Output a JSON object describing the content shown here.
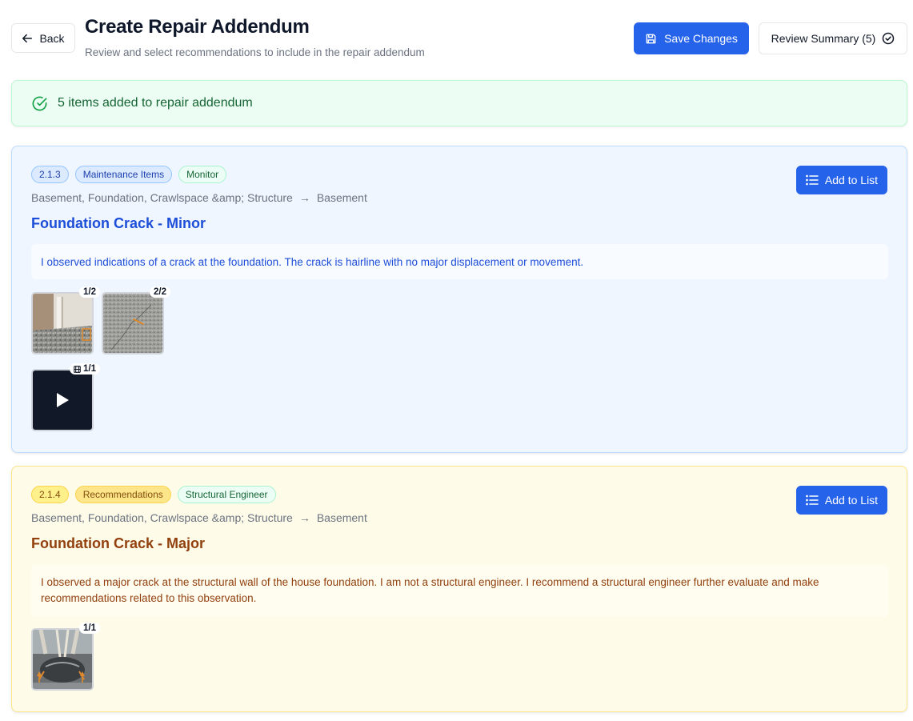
{
  "header": {
    "back_label": "Back",
    "title": "Create Repair Addendum",
    "subtitle": "Review and select recommendations to include in the repair addendum",
    "save_label": "Save Changes",
    "review_label": "Review Summary (5)"
  },
  "banner": {
    "text": "5 items added to repair addendum"
  },
  "items": [
    {
      "number": "2.1.3",
      "category": "Maintenance Items",
      "tag": "Monitor",
      "section": "Basement, Foundation, Crawlspace &amp; Structure",
      "arrow": "→",
      "location": "Basement",
      "title": "Foundation Crack - Minor",
      "description": "I observed indications of a crack at the foundation. The crack is hairline with no major displacement or movement.",
      "add_label": "Add to List",
      "photos": [
        {
          "counter": "1/2"
        },
        {
          "counter": "2/2"
        }
      ],
      "videos": [
        {
          "counter": "1/1"
        }
      ]
    },
    {
      "number": "2.1.4",
      "category": "Recommendations",
      "tag": "Structural Engineer",
      "section": "Basement, Foundation, Crawlspace &amp; Structure",
      "arrow": "→",
      "location": "Basement",
      "title": "Foundation Crack - Major",
      "description": "I observed a major crack at the structural wall of the house foundation. I am not a structural engineer. I recommend a structural engineer further evaluate and make recommendations related to this observation.",
      "add_label": "Add to List",
      "photos": [
        {
          "counter": "1/1"
        }
      ]
    }
  ],
  "colors": {
    "primary": "#2563eb",
    "success_bg": "#ecfdf3",
    "success_text": "#166534",
    "blue_card": "#eff6ff",
    "amber_card": "#fefce8"
  },
  "icons": [
    "arrow-left-icon",
    "save-icon",
    "check-circle-icon",
    "list-icon",
    "play-icon",
    "film-icon"
  ]
}
